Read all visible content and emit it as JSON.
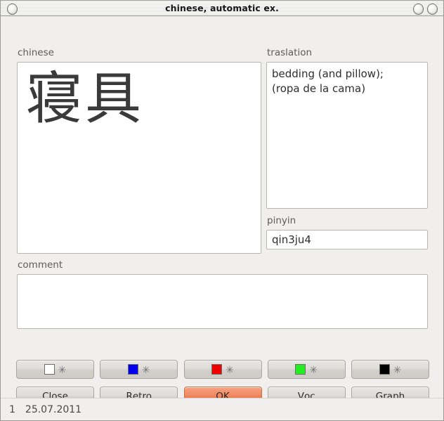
{
  "window": {
    "title": "chinese, automatic ex.",
    "controls": {
      "left_button": "window-menu",
      "right_button_1": "minimize",
      "right_button_2": "close"
    }
  },
  "fields": {
    "chinese": {
      "label": "chinese",
      "value": "寝具",
      "placeholder": ""
    },
    "traslation": {
      "label": "traslation",
      "value": "bedding (and pillow);\n(ropa de la cama)",
      "placeholder": ""
    },
    "pinyin": {
      "label": "pinyin",
      "value": "qin3ju4",
      "placeholder": ""
    },
    "comment": {
      "label": "comment",
      "value": "",
      "placeholder": ""
    }
  },
  "color_buttons": [
    {
      "name": "white",
      "color": "#ffffff",
      "mark": "✳"
    },
    {
      "name": "blue",
      "color": "#0000ee",
      "mark": "✳"
    },
    {
      "name": "red",
      "color": "#ee0000",
      "mark": "✳"
    },
    {
      "name": "green",
      "color": "#22ee22",
      "mark": "✳"
    },
    {
      "name": "black",
      "color": "#000000",
      "mark": "✳"
    }
  ],
  "action_buttons": [
    {
      "mnemonic": "C",
      "rest": "lose",
      "accent": "#cecbc6"
    },
    {
      "mnemonic": "R",
      "rest": "etro",
      "accent": "#cecbc6"
    },
    {
      "mnemonic": "O",
      "rest": "K",
      "accent": "#ec7d55"
    },
    {
      "mnemonic": "V",
      "rest": "oc",
      "accent": "#cecbc6"
    },
    {
      "mnemonic": "G",
      "rest": "raph",
      "accent": "#cecbc6"
    }
  ],
  "statusbar": {
    "index": "1",
    "date": "25.07.2011"
  }
}
